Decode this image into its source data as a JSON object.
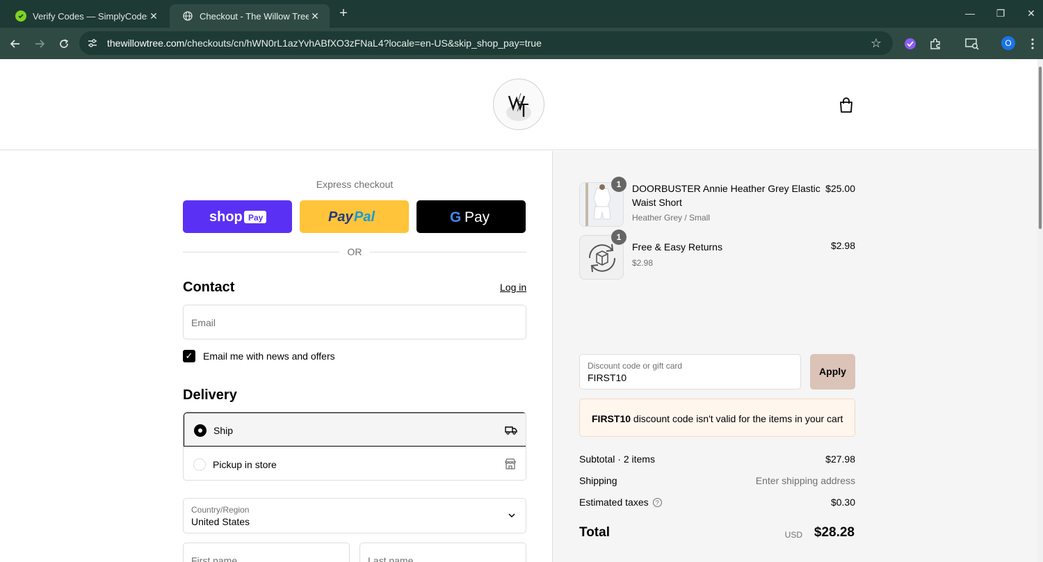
{
  "browser": {
    "tabs": [
      {
        "title": "Verify Codes — SimplyCodes",
        "active": false
      },
      {
        "title": "Checkout - The Willow Tree Bou",
        "active": true
      }
    ],
    "url_host": "thewillowtree.com",
    "url_path": "/checkouts/cn/hWN0rL1azYvhABfXO3zFNaL4?locale=en-US&skip_shop_pay=true",
    "profile_initial": "O"
  },
  "checkout": {
    "express_label": "Express checkout",
    "or_label": "OR",
    "contact": {
      "heading": "Contact",
      "login_label": "Log in",
      "email_placeholder": "Email",
      "newsletter_label": "Email me with news and offers",
      "newsletter_checked": true
    },
    "delivery": {
      "heading": "Delivery",
      "options": [
        {
          "label": "Ship",
          "selected": true
        },
        {
          "label": "Pickup in store",
          "selected": false
        }
      ],
      "country_label": "Country/Region",
      "country_value": "United States",
      "first_name_placeholder": "First name",
      "last_name_placeholder": "Last name"
    }
  },
  "summary": {
    "items": [
      {
        "name_line1": "DOORBUSTER Annie Heather Grey Elastic",
        "name_line2": "Waist Short",
        "variant": "Heather Grey / Small",
        "price": "$25.00",
        "qty": "1"
      },
      {
        "name_line1": "Free & Easy Returns",
        "name_line2": "",
        "variant": "$2.98",
        "price": "$2.98",
        "qty": "1"
      }
    ],
    "discount": {
      "label": "Discount code or gift card",
      "value": "FIRST10",
      "apply_label": "Apply",
      "error_code": "FIRST10",
      "error_text": " discount code isn't valid for the items in your cart"
    },
    "subtotal_label": "Subtotal · 2 items",
    "subtotal_value": "$27.98",
    "shipping_label": "Shipping",
    "shipping_value": "Enter shipping address",
    "taxes_label": "Estimated taxes",
    "taxes_value": "$0.30",
    "total_label": "Total",
    "total_currency": "USD",
    "total_value": "$28.28"
  },
  "colors": {
    "shop_pay": "#5a31f4",
    "paypal": "#ffc439",
    "gpay": "#000000",
    "apply_button": "#dbc3b7",
    "notice_bg": "#fff6ee"
  }
}
